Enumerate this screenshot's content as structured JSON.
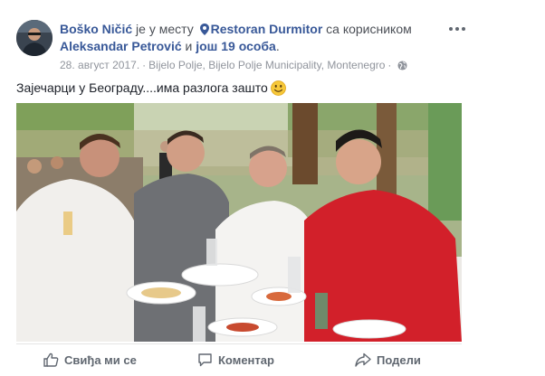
{
  "post": {
    "author": "Boško Ničić",
    "at_text": "је у месту",
    "place": "Restoran Durmitor",
    "with_text": "са корисником",
    "tagged_person": "Aleksandar Petrović",
    "and_text": "и",
    "others_link": "још 19 особа",
    "period": ".",
    "date": "28. август 2017.",
    "location": "Bijelo Polje, Bijelo Polje Municipality, Montenegro",
    "privacy_icon": "globe-icon",
    "text": "Зајечарци у Београду....има разлога зашто",
    "emoji": "smiley-emoji",
    "photo_description_icon": "restaurant-photo"
  },
  "actions": {
    "like": "Свиђа ми се",
    "comment": "Коментар",
    "share": "Подели"
  },
  "colors": {
    "link": "#385898",
    "meta": "#90949c",
    "action": "#606770",
    "border": "#e5e5e5"
  }
}
